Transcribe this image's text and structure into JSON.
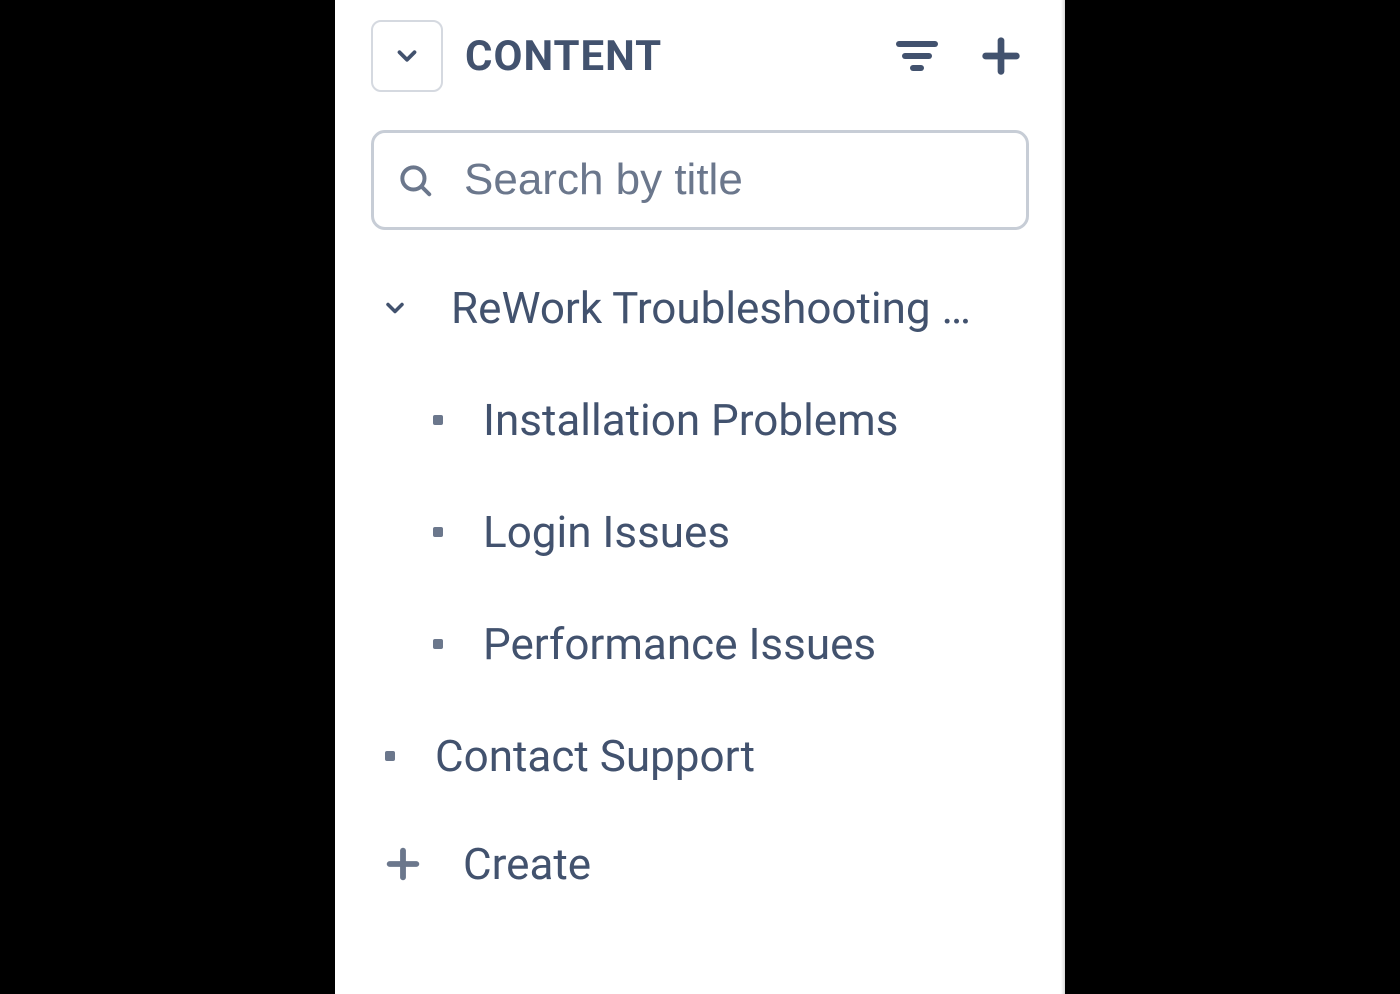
{
  "header": {
    "title": "CONTENT"
  },
  "search": {
    "placeholder": "Search by title"
  },
  "tree": {
    "root": {
      "label": "ReWork Troubleshooting …",
      "children": [
        {
          "label": "Installation Problems"
        },
        {
          "label": "Login Issues"
        },
        {
          "label": "Performance Issues"
        }
      ]
    },
    "siblings": [
      {
        "label": "Contact Support"
      }
    ]
  },
  "create": {
    "label": "Create"
  }
}
